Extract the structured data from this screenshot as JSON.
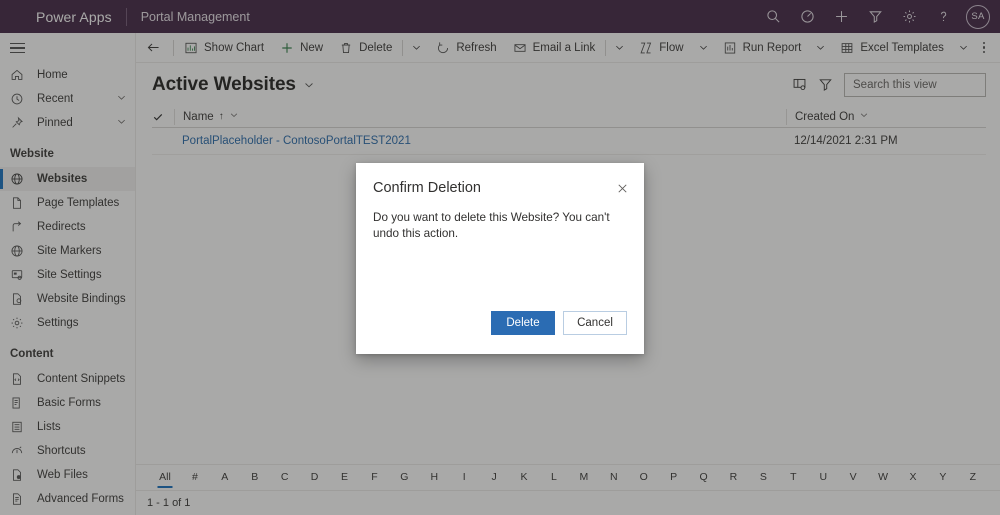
{
  "header": {
    "brand": "Power Apps",
    "app_name": "Portal Management",
    "icons": [
      "search-icon",
      "timer-icon",
      "plus-icon",
      "filter-icon",
      "gear-icon",
      "help-icon"
    ],
    "avatar_initials": "SA",
    "background_color": "#3b1e3f"
  },
  "sidebar": {
    "top_items": [
      {
        "label": "Home",
        "icon": "home-icon",
        "expandable": false
      },
      {
        "label": "Recent",
        "icon": "clock-icon",
        "expandable": true
      },
      {
        "label": "Pinned",
        "icon": "pin-icon",
        "expandable": true
      }
    ],
    "groups": [
      {
        "title": "Website",
        "items": [
          {
            "label": "Websites",
            "icon": "globe-icon",
            "selected": true
          },
          {
            "label": "Page Templates",
            "icon": "page-icon",
            "selected": false
          },
          {
            "label": "Redirects",
            "icon": "redirect-icon",
            "selected": false
          },
          {
            "label": "Site Markers",
            "icon": "globe-icon",
            "selected": false
          },
          {
            "label": "Site Settings",
            "icon": "site-settings-icon",
            "selected": false
          },
          {
            "label": "Website Bindings",
            "icon": "binding-icon",
            "selected": false
          },
          {
            "label": "Settings",
            "icon": "gear-icon",
            "selected": false
          }
        ]
      },
      {
        "title": "Content",
        "items": [
          {
            "label": "Content Snippets",
            "icon": "snippet-icon",
            "selected": false
          },
          {
            "label": "Basic Forms",
            "icon": "form-icon",
            "selected": false
          },
          {
            "label": "Lists",
            "icon": "list-icon",
            "selected": false
          },
          {
            "label": "Shortcuts",
            "icon": "shortcut-icon",
            "selected": false
          },
          {
            "label": "Web Files",
            "icon": "webfile-icon",
            "selected": false
          },
          {
            "label": "Advanced Forms",
            "icon": "advanced-form-icon",
            "selected": false
          }
        ]
      }
    ],
    "selected_accent": "#0f6cbd"
  },
  "command_bar": {
    "back_label": "",
    "items": [
      {
        "label": "Show Chart",
        "icon": "chart-icon",
        "caret": false
      },
      {
        "label": "New",
        "icon": "plus-icon",
        "caret": false
      },
      {
        "label": "Delete",
        "icon": "trash-icon",
        "caret": true
      },
      {
        "label": "Refresh",
        "icon": "refresh-icon",
        "caret": false
      },
      {
        "label": "Email a Link",
        "icon": "email-link-icon",
        "caret": true
      },
      {
        "label": "Flow",
        "icon": "flow-icon",
        "caret": true
      },
      {
        "label": "Run Report",
        "icon": "report-icon",
        "caret": true
      },
      {
        "label": "Excel Templates",
        "icon": "excel-icon",
        "caret": true
      }
    ],
    "overflow_label": "More commands"
  },
  "view": {
    "title": "Active Websites",
    "edit_columns_icon": "edit-columns-icon",
    "filter_icon": "filter-icon",
    "search_placeholder": "Search this view",
    "search_value": "",
    "search_icon": "search-icon"
  },
  "grid": {
    "columns": [
      {
        "label": "Name",
        "sort": "ascending"
      },
      {
        "label": "Created On",
        "sort": ""
      }
    ],
    "rows": [
      {
        "name": "PortalPlaceholder - ContosoPortalTEST2021",
        "created_on": "12/14/2021 2:31 PM"
      }
    ],
    "link_color": "#2266aa"
  },
  "alpha_filter": {
    "letters": [
      "All",
      "#",
      "A",
      "B",
      "C",
      "D",
      "E",
      "F",
      "G",
      "H",
      "I",
      "J",
      "K",
      "L",
      "M",
      "N",
      "O",
      "P",
      "Q",
      "R",
      "S",
      "T",
      "U",
      "V",
      "W",
      "X",
      "Y",
      "Z"
    ],
    "active": "All",
    "accent": "#0f6cbd"
  },
  "status": {
    "record_count": "1 - 1 of 1"
  },
  "dialog": {
    "title": "Confirm Deletion",
    "message": "Do you want to delete this Website? You can't undo this action.",
    "close_icon": "close-icon",
    "primary_label": "Delete",
    "secondary_label": "Cancel",
    "primary_color": "#2b6cb3"
  }
}
